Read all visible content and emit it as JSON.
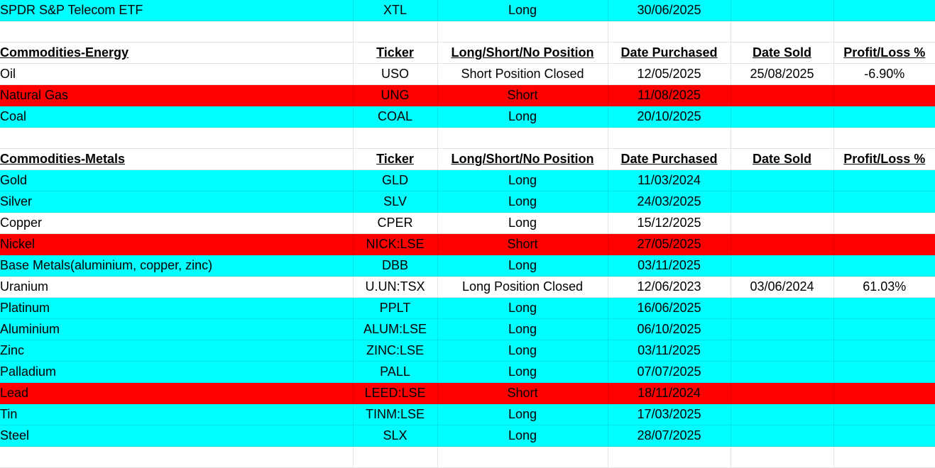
{
  "colors": {
    "long_highlight": "#00ffff",
    "short_highlight": "#ff0000",
    "gridline": "#e2e2e2"
  },
  "rows": [
    {
      "kind": "data",
      "highlight": "cyan",
      "cells": [
        "SPDR S&P Telecom ETF",
        "XTL",
        "Long",
        "30/06/2025",
        "",
        ""
      ]
    },
    {
      "kind": "empty",
      "highlight": "none",
      "cells": [
        "",
        "",
        "",
        "",
        "",
        ""
      ]
    },
    {
      "kind": "header",
      "highlight": "none",
      "cells": [
        "Commodities-Energy",
        "Ticker",
        "Long/Short/No Position",
        "Date Purchased",
        "Date Sold",
        "Profit/Loss %"
      ]
    },
    {
      "kind": "data",
      "highlight": "none",
      "cells": [
        "Oil",
        "USO",
        "Short Position Closed",
        "12/05/2025",
        "25/08/2025",
        "-6.90%"
      ]
    },
    {
      "kind": "data",
      "highlight": "red",
      "cells": [
        "Natural Gas",
        "UNG",
        "Short",
        "11/08/2025",
        "",
        ""
      ]
    },
    {
      "kind": "data",
      "highlight": "cyan",
      "cells": [
        "Coal",
        "COAL",
        "Long",
        "20/10/2025",
        "",
        ""
      ]
    },
    {
      "kind": "empty",
      "highlight": "none",
      "cells": [
        "",
        "",
        "",
        "",
        "",
        ""
      ]
    },
    {
      "kind": "header",
      "highlight": "none",
      "cells": [
        "Commodities-Metals",
        "Ticker",
        "Long/Short/No Position",
        "Date Purchased",
        "Date Sold",
        "Profit/Loss %"
      ]
    },
    {
      "kind": "data",
      "highlight": "cyan",
      "cells": [
        "Gold",
        "GLD",
        "Long",
        "11/03/2024",
        "",
        ""
      ]
    },
    {
      "kind": "data",
      "highlight": "cyan",
      "cells": [
        "Silver",
        "SLV",
        "Long",
        "24/03/2025",
        "",
        ""
      ]
    },
    {
      "kind": "data",
      "highlight": "none",
      "cells": [
        "Copper",
        "CPER",
        "Long",
        "15/12/2025",
        "",
        ""
      ]
    },
    {
      "kind": "data",
      "highlight": "red",
      "cells": [
        "Nickel",
        "NICK:LSE",
        "Short",
        "27/05/2025",
        "",
        ""
      ]
    },
    {
      "kind": "data",
      "highlight": "cyan",
      "cells": [
        "Base Metals(aluminium, copper, zinc)",
        "DBB",
        "Long",
        "03/11/2025",
        "",
        ""
      ]
    },
    {
      "kind": "data",
      "highlight": "none",
      "cells": [
        "Uranium",
        "U.UN:TSX",
        "Long Position Closed",
        "12/06/2023",
        "03/06/2024",
        "61.03%"
      ]
    },
    {
      "kind": "data",
      "highlight": "cyan",
      "cells": [
        "Platinum",
        "PPLT",
        "Long",
        "16/06/2025",
        "",
        ""
      ]
    },
    {
      "kind": "data",
      "highlight": "cyan",
      "cells": [
        "Aluminium",
        "ALUM:LSE",
        "Long",
        "06/10/2025",
        "",
        ""
      ]
    },
    {
      "kind": "data",
      "highlight": "cyan",
      "cells": [
        "Zinc",
        "ZINC:LSE",
        "Long",
        "03/11/2025",
        "",
        ""
      ]
    },
    {
      "kind": "data",
      "highlight": "cyan",
      "cells": [
        "Palladium",
        "PALL",
        "Long",
        "07/07/2025",
        "",
        ""
      ]
    },
    {
      "kind": "data",
      "highlight": "red",
      "cells": [
        "Lead",
        "LEED:LSE",
        "Short",
        "18/11/2024",
        "",
        ""
      ]
    },
    {
      "kind": "data",
      "highlight": "cyan",
      "cells": [
        "Tin",
        "TINM:LSE",
        "Long",
        "17/03/2025",
        "",
        ""
      ]
    },
    {
      "kind": "data",
      "highlight": "cyan",
      "cells": [
        "Steel",
        "SLX",
        "Long",
        "28/07/2025",
        "",
        ""
      ]
    },
    {
      "kind": "empty",
      "highlight": "none",
      "cells": [
        "",
        "",
        "",
        "",
        "",
        ""
      ]
    }
  ]
}
